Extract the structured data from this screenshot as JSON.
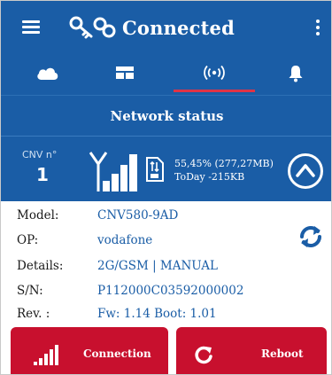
{
  "app": {
    "title": "Connected"
  },
  "tabs": [
    {
      "icon": "cloud-icon"
    },
    {
      "icon": "dashboard-icon"
    },
    {
      "icon": "wireless-broadcast-icon",
      "active": true
    },
    {
      "icon": "bell-icon"
    }
  ],
  "section": {
    "title": "Network status"
  },
  "signal": {
    "cnv_label": "CNV n°",
    "cnv_value": "1",
    "usage_line1": "55,45%  (277,27MB)",
    "usage_line2": "ToDay -215KB"
  },
  "details": [
    {
      "key": "Model:",
      "value": "CNV580-9AD"
    },
    {
      "key": "OP:",
      "value": "vodafone"
    },
    {
      "key": "Details:",
      "value": "2G/GSM | MANUAL"
    },
    {
      "key": "S/N:",
      "value": "P112000C03592000002"
    },
    {
      "key": "Rev. :",
      "value": "Fw: 1.14  Boot: 1.01"
    }
  ],
  "actions": {
    "connection_label": "Connection",
    "reboot_label": "Reboot"
  },
  "colors": {
    "primary": "#1a5da6",
    "accent": "#c8102e",
    "tab_indicator": "#e03446"
  }
}
